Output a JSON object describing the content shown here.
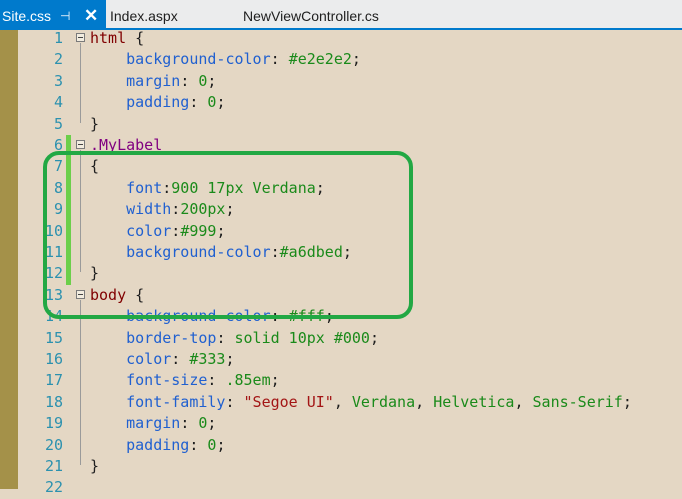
{
  "tabs": [
    {
      "label": "Site.css",
      "active": true,
      "pin": "⊣",
      "close": "✕"
    },
    {
      "label": "Index.aspx",
      "active": false
    },
    {
      "label": "NewViewController.cs",
      "active": false
    }
  ],
  "colors": {
    "accent": "#007acc",
    "editor_bg": "#e4d7c4",
    "highlight": "#22a844",
    "line_number": "#2b91af",
    "property": "#2060d0",
    "value": "#1a8a1a",
    "selector": "#800000",
    "string": "#a31515",
    "change_bar": "#6ccf4a"
  },
  "lines": [
    {
      "n": "1",
      "fold": true,
      "parts": [
        {
          "t": "html",
          "c": "sel"
        },
        {
          "t": " {",
          "c": "pun"
        }
      ]
    },
    {
      "n": "2",
      "parts": [
        {
          "t": "    background-color",
          "c": "prop"
        },
        {
          "t": ": ",
          "c": "pun"
        },
        {
          "t": "#e2e2e2",
          "c": "val"
        },
        {
          "t": ";",
          "c": "pun"
        }
      ]
    },
    {
      "n": "3",
      "parts": [
        {
          "t": "    margin",
          "c": "prop"
        },
        {
          "t": ": ",
          "c": "pun"
        },
        {
          "t": "0",
          "c": "val"
        },
        {
          "t": ";",
          "c": "pun"
        }
      ]
    },
    {
      "n": "4",
      "parts": [
        {
          "t": "    padding",
          "c": "prop"
        },
        {
          "t": ": ",
          "c": "pun"
        },
        {
          "t": "0",
          "c": "val"
        },
        {
          "t": ";",
          "c": "pun"
        }
      ]
    },
    {
      "n": "5",
      "parts": [
        {
          "t": "}",
          "c": "pun"
        }
      ]
    },
    {
      "n": "6",
      "fold": true,
      "changed": true,
      "parts": [
        {
          "t": ".MyLabel",
          "c": "cls"
        }
      ]
    },
    {
      "n": "7",
      "changed": true,
      "parts": [
        {
          "t": "{",
          "c": "pun"
        }
      ]
    },
    {
      "n": "8",
      "changed": true,
      "parts": [
        {
          "t": "    font",
          "c": "prop"
        },
        {
          "t": ":",
          "c": "pun"
        },
        {
          "t": "900 17px Verdana",
          "c": "val"
        },
        {
          "t": ";",
          "c": "pun"
        }
      ]
    },
    {
      "n": "9",
      "changed": true,
      "parts": [
        {
          "t": "    width",
          "c": "prop"
        },
        {
          "t": ":",
          "c": "pun"
        },
        {
          "t": "200px",
          "c": "val"
        },
        {
          "t": ";",
          "c": "pun"
        }
      ]
    },
    {
      "n": "10",
      "changed": true,
      "parts": [
        {
          "t": "    color",
          "c": "prop"
        },
        {
          "t": ":",
          "c": "pun"
        },
        {
          "t": "#999",
          "c": "val"
        },
        {
          "t": ";",
          "c": "pun"
        }
      ]
    },
    {
      "n": "11",
      "changed": true,
      "parts": [
        {
          "t": "    background-color",
          "c": "prop"
        },
        {
          "t": ":",
          "c": "pun"
        },
        {
          "t": "#a6dbed",
          "c": "val"
        },
        {
          "t": ";",
          "c": "pun"
        }
      ]
    },
    {
      "n": "12",
      "changed": true,
      "parts": [
        {
          "t": "}",
          "c": "pun"
        }
      ]
    },
    {
      "n": "13",
      "fold": true,
      "parts": [
        {
          "t": "body",
          "c": "sel"
        },
        {
          "t": " {",
          "c": "pun"
        }
      ]
    },
    {
      "n": "14",
      "parts": [
        {
          "t": "    background-color",
          "c": "prop"
        },
        {
          "t": ": ",
          "c": "pun"
        },
        {
          "t": "#fff",
          "c": "val"
        },
        {
          "t": ";",
          "c": "pun"
        }
      ]
    },
    {
      "n": "15",
      "parts": [
        {
          "t": "    border-top",
          "c": "prop"
        },
        {
          "t": ": ",
          "c": "pun"
        },
        {
          "t": "solid 10px #000",
          "c": "val"
        },
        {
          "t": ";",
          "c": "pun"
        }
      ]
    },
    {
      "n": "16",
      "parts": [
        {
          "t": "    color",
          "c": "prop"
        },
        {
          "t": ": ",
          "c": "pun"
        },
        {
          "t": "#333",
          "c": "val"
        },
        {
          "t": ";",
          "c": "pun"
        }
      ]
    },
    {
      "n": "17",
      "parts": [
        {
          "t": "    font-size",
          "c": "prop"
        },
        {
          "t": ": ",
          "c": "pun"
        },
        {
          "t": ".85em",
          "c": "val"
        },
        {
          "t": ";",
          "c": "pun"
        }
      ]
    },
    {
      "n": "18",
      "parts": [
        {
          "t": "    font-family",
          "c": "prop"
        },
        {
          "t": ": ",
          "c": "pun"
        },
        {
          "t": "\"Segoe UI\"",
          "c": "str"
        },
        {
          "t": ", ",
          "c": "pun"
        },
        {
          "t": "Verdana",
          "c": "val"
        },
        {
          "t": ", ",
          "c": "pun"
        },
        {
          "t": "Helvetica",
          "c": "val"
        },
        {
          "t": ", ",
          "c": "pun"
        },
        {
          "t": "Sans-Serif",
          "c": "val"
        },
        {
          "t": ";",
          "c": "pun"
        }
      ]
    },
    {
      "n": "19",
      "parts": [
        {
          "t": "    margin",
          "c": "prop"
        },
        {
          "t": ": ",
          "c": "pun"
        },
        {
          "t": "0",
          "c": "val"
        },
        {
          "t": ";",
          "c": "pun"
        }
      ]
    },
    {
      "n": "20",
      "parts": [
        {
          "t": "    padding",
          "c": "prop"
        },
        {
          "t": ": ",
          "c": "pun"
        },
        {
          "t": "0",
          "c": "val"
        },
        {
          "t": ";",
          "c": "pun"
        }
      ]
    },
    {
      "n": "21",
      "parts": [
        {
          "t": "}",
          "c": "pun"
        }
      ]
    },
    {
      "n": "22",
      "parts": []
    }
  ]
}
